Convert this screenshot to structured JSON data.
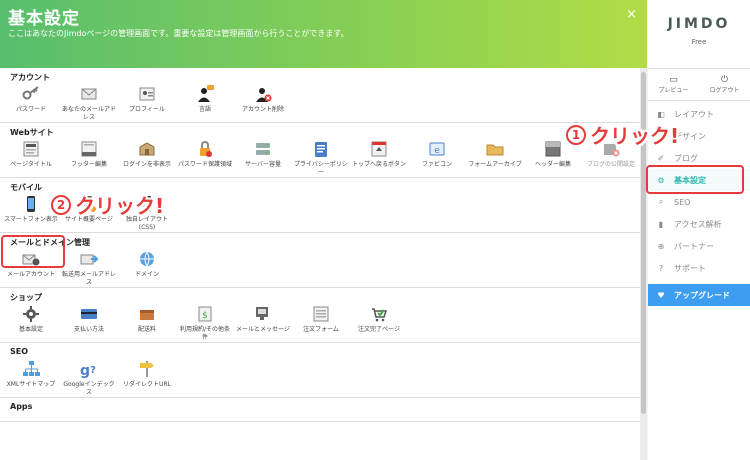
{
  "header": {
    "title": "基本設定",
    "subtitle": "ここはあなたのJimdoページの管理画面です。重要な設定は管理画面から行うことができます。",
    "close_symbol": "×"
  },
  "sections": [
    {
      "title": "アカウント",
      "items": [
        {
          "label": "パスワード",
          "icon": "key-icon"
        },
        {
          "label": "あなたのメールアドレス",
          "icon": "mail-icon"
        },
        {
          "label": "プロフィール",
          "icon": "profile-card-icon"
        },
        {
          "label": "言語",
          "icon": "language-user-icon"
        },
        {
          "label": "アカウント削除",
          "icon": "delete-user-icon"
        }
      ]
    },
    {
      "title": "Webサイト",
      "items": [
        {
          "label": "ページタイトル",
          "icon": "page-title-icon"
        },
        {
          "label": "フッター編集",
          "icon": "footer-icon"
        },
        {
          "label": "ログインを非表示",
          "icon": "hide-login-icon"
        },
        {
          "label": "パスワード保護領域",
          "icon": "lock-icon"
        },
        {
          "label": "サーバー容量",
          "icon": "server-icon"
        },
        {
          "label": "プライバシーポリシー",
          "icon": "privacy-icon"
        },
        {
          "label": "トップへ戻るボタン",
          "icon": "back-to-top-icon"
        },
        {
          "label": "ファビコン",
          "icon": "favicon-icon"
        },
        {
          "label": "フォームアーカイブ",
          "icon": "folder-icon"
        },
        {
          "label": "ヘッダー編集",
          "icon": "header-icon"
        },
        {
          "label": "ブログの公開設定",
          "icon": "blog-settings-icon"
        }
      ]
    },
    {
      "title": "モバイル",
      "items": [
        {
          "label": "スマートフォン表示",
          "icon": "smartphone-icon"
        },
        {
          "label": "サイト概要ページ",
          "icon": "site-summary-icon"
        },
        {
          "label": "独自レイアウト (CSS)",
          "icon": "custom-layout-icon"
        }
      ]
    },
    {
      "title": "メールとドメイン管理",
      "items": [
        {
          "label": "メールアカウント",
          "icon": "mail-account-icon"
        },
        {
          "label": "転送用メールアドレス",
          "icon": "mail-forward-icon"
        },
        {
          "label": "ドメイン",
          "icon": "domain-globe-icon"
        }
      ]
    },
    {
      "title": "ショップ",
      "items": [
        {
          "label": "基本設定",
          "icon": "shop-settings-icon"
        },
        {
          "label": "支払い方法",
          "icon": "credit-card-icon"
        },
        {
          "label": "配送料",
          "icon": "shipping-box-icon"
        },
        {
          "label": "利用規約/その他条件",
          "icon": "terms-icon"
        },
        {
          "label": "メールとメッセージ",
          "icon": "message-icon"
        },
        {
          "label": "注文フォーム",
          "icon": "order-form-icon"
        },
        {
          "label": "注文完了ページ",
          "icon": "order-complete-icon"
        }
      ]
    },
    {
      "title": "SEO",
      "items": [
        {
          "label": "XMLサイトマップ",
          "icon": "sitemap-icon"
        },
        {
          "label": "Googleインデックス",
          "icon": "google-index-icon"
        },
        {
          "label": "リダイレクトURL",
          "icon": "redirect-sign-icon"
        }
      ]
    },
    {
      "title": "Apps",
      "items": []
    }
  ],
  "sidebar": {
    "logo": "JIMDO",
    "plan": "Free",
    "preview_label": "プレビュー",
    "preview_symbol": "▭",
    "logout_label": "ログアウト",
    "logout_symbol": "⏻",
    "nav": [
      {
        "label": "レイアウト",
        "icon": "layout-icon",
        "symbol": "◧"
      },
      {
        "label": "デザイン",
        "icon": "design-icon",
        "symbol": "✎"
      },
      {
        "label": "ブログ",
        "icon": "blog-icon",
        "symbol": "✐"
      },
      {
        "label": "基本設定",
        "icon": "gear-icon",
        "symbol": "⚙"
      },
      {
        "label": "SEO",
        "icon": "seo-search-icon",
        "symbol": "⌕"
      },
      {
        "label": "アクセス解析",
        "icon": "analytics-icon",
        "symbol": "▮"
      },
      {
        "label": "パートナー",
        "icon": "partner-icon",
        "symbol": "⊕"
      },
      {
        "label": "サポート",
        "icon": "support-icon",
        "symbol": "?"
      },
      {
        "label": "アップグレード",
        "icon": "heart-icon",
        "symbol": "♥"
      }
    ]
  },
  "annotations": {
    "step1": {
      "number": "1",
      "text": "クリック!"
    },
    "step2": {
      "number": "2",
      "text": "クリック!"
    }
  },
  "colors": {
    "highlight": "#e53b3b",
    "accent": "#2fb4b0",
    "upgrade": "#3d9df0"
  }
}
